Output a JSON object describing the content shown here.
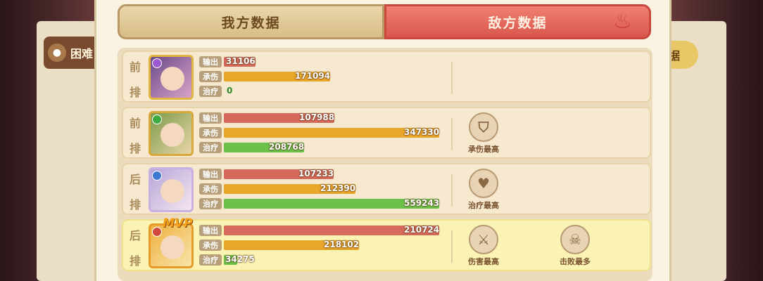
{
  "header": {
    "tab_mine": "我方数据",
    "tab_enemy": "敌方数据",
    "side_tab": "困难",
    "right_tab": "据"
  },
  "stat_labels": {
    "output": "输出",
    "tank": "承伤",
    "heal": "治疗"
  },
  "rows": [
    {
      "position": [
        "前",
        "排"
      ],
      "mvp": false,
      "output": 31106,
      "output_label": "31106",
      "tank": 171094,
      "tank_label": "171094",
      "heal": 0,
      "heal_label": "0",
      "awards": []
    },
    {
      "position": [
        "前",
        "排"
      ],
      "mvp": false,
      "output": 107988,
      "output_label": "107988",
      "tank": 347330,
      "tank_label": "347330",
      "heal": 208768,
      "heal_label": "208768",
      "awards": [
        {
          "icon": "shield-icon",
          "label": "承伤最高"
        }
      ]
    },
    {
      "position": [
        "后",
        "排"
      ],
      "mvp": false,
      "output": 107233,
      "output_label": "107233",
      "tank": 212390,
      "tank_label": "212390",
      "heal": 559243,
      "heal_label": "559243",
      "awards": [
        {
          "icon": "heart-plus-icon",
          "label": "治疗最高"
        }
      ]
    },
    {
      "position": [
        "后",
        "排"
      ],
      "mvp": true,
      "mvp_text": "MVP",
      "output": 210724,
      "output_label": "210724",
      "tank": 218102,
      "tank_label": "218102",
      "heal": 34275,
      "heal_label": "34275",
      "awards": [
        {
          "icon": "sword-icon",
          "label": "伤害最高"
        },
        {
          "icon": "skull-icon",
          "label": "击败最多"
        }
      ]
    }
  ],
  "bar_max": {
    "output": 210724,
    "tank": 347330,
    "heal": 559243
  },
  "colors": {
    "output": "#d66a5c",
    "tank": "#e8a62a",
    "heal": "#6bc04a",
    "enemy_tab": "#d9574d",
    "mvp_row": "#fbf3b3"
  }
}
